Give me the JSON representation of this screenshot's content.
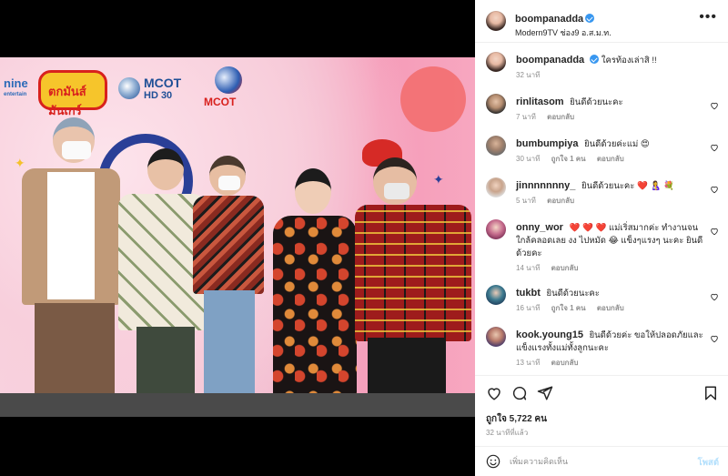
{
  "photo": {
    "logos": {
      "nine": "nine",
      "nine_sub": "entertain",
      "show": "ตกมันส์ มันเกร์",
      "mcothd": "MCOT",
      "mcothd_sub": "HD 30",
      "mcot": "MCOT"
    }
  },
  "header": {
    "username": "boompanadda",
    "location": "Modern9TV ช่อง9 อ.ส.ม.ท."
  },
  "caption": {
    "username": "boompanadda",
    "text": "ใครท้องเล่าสิ !!",
    "time": "32 นาที"
  },
  "comments": [
    {
      "username": "rinlitasom",
      "text": "ยินดีด้วยนะคะ",
      "time": "7 นาที",
      "likes": "",
      "reply": "ตอบกลับ"
    },
    {
      "username": "bumbumpiya",
      "text": "ยินดีด้วยค่ะแม่ 😍",
      "time": "30 นาที",
      "likes": "ถูกใจ 1 คน",
      "reply": "ตอบกลับ"
    },
    {
      "username": "jinnnnnnny_",
      "text": "ยินดีด้วยนะคะ ❤️ 🤱 💐",
      "time": "5 นาที",
      "likes": "",
      "reply": "ตอบกลับ"
    },
    {
      "username": "onny_wor",
      "text": "❤️ ❤️ ❤️ แม่เริ่สมากค่ะ ทำงานจนใกล้คลอดเลย งง ไปหมัด 😂 แข็งๆแรงๆ นะคะ ยินดีด้วยคะ",
      "time": "14 นาที",
      "likes": "",
      "reply": "ตอบกลับ"
    },
    {
      "username": "tukbt",
      "text": "ยินดีด้วยนะคะ",
      "time": "16 นาที",
      "likes": "ถูกใจ 1 คน",
      "reply": "ตอบกลับ"
    },
    {
      "username": "kook.young15",
      "text": "ยินดีด้วยค่ะ ขอให้ปลอดภัยและแข็งแรงทั้งแม่ทั้งลูกนะคะ",
      "time": "13 นาที",
      "likes": "",
      "reply": "ตอบกลับ"
    }
  ],
  "actions": {
    "likes": "ถูกใจ 5,722 คน",
    "time_ago": "32 นาทีที่แล้ว"
  },
  "comment_box": {
    "placeholder": "เพิ่มความคิดเห็น",
    "post_label": "โพสต์"
  },
  "icons": {
    "more": "more-options-icon",
    "heart": "heart-icon",
    "comment": "comment-icon",
    "share": "share-icon",
    "save": "bookmark-icon",
    "emoji": "emoji-icon"
  },
  "colors": {
    "verified": "#3897f0",
    "post_disabled": "#b2dffc",
    "meta": "#8e8e8e"
  }
}
